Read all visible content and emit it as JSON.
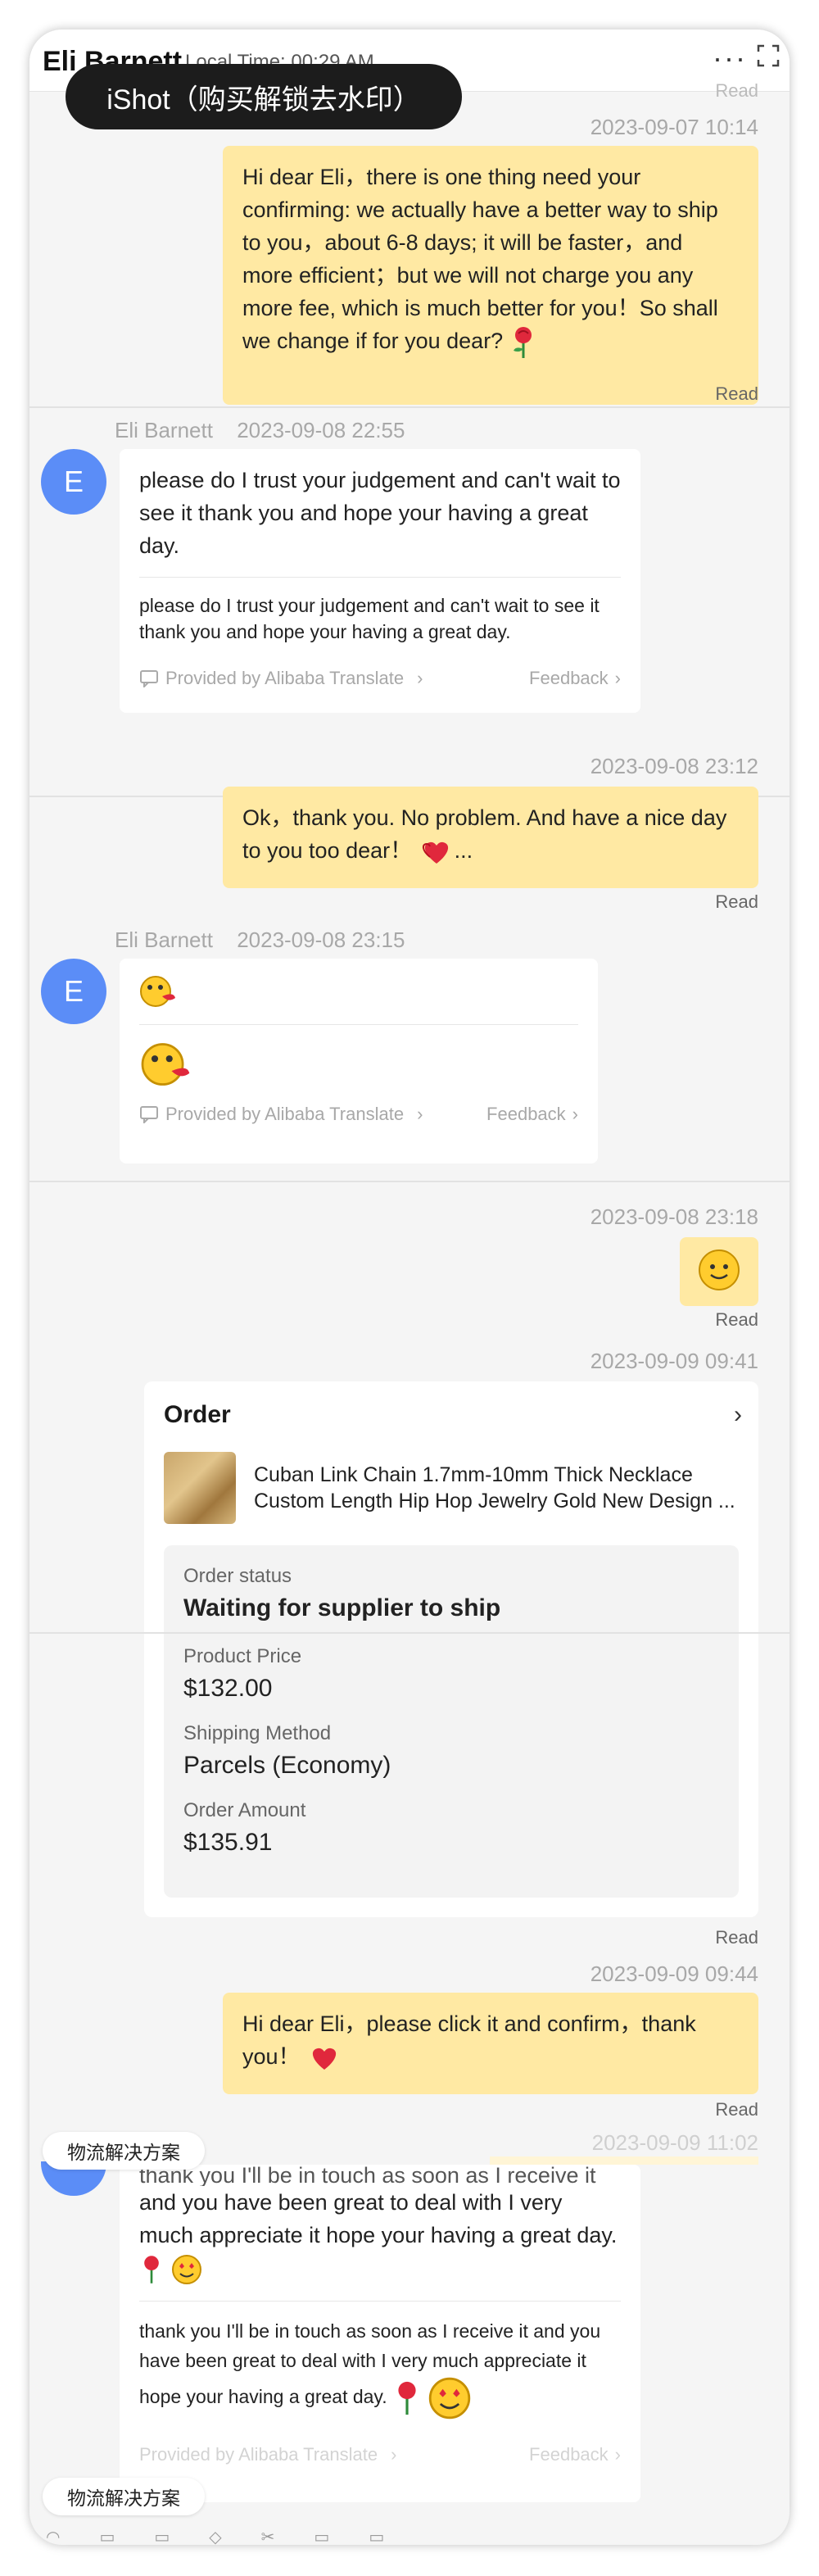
{
  "header": {
    "contact_name": "Eli Barnett",
    "local_time": "Local Time: 00:29 AM",
    "more_icon": "more-horizontal-icon",
    "expand_icon": "fullscreen-icon"
  },
  "watermark": "iShot（购买解锁去水印）",
  "top_read": "Read",
  "messages": {
    "m1": {
      "time": "2023-09-07 10:14",
      "text": "Hi dear Eli，there is one thing need your confirming: we actually have a better way to ship to you，about 6-8 days; it will be faster，and more efficient；but we will not charge you any more fee, which is much better for you！So shall we change if for you dear?",
      "emoji": "rose-icon",
      "status": "Read"
    },
    "m2": {
      "sender": "Eli Barnett",
      "time": "2023-09-08 22:55",
      "avatar": "E",
      "text": "please do I trust your judgement and can't wait to see it thank you and hope your having a great day.",
      "translation": "please do I trust your judgement and can't wait to see it thank you and hope your having a great day.",
      "provided": "Provided by Alibaba Translate",
      "feedback": "Feedback"
    },
    "m3": {
      "time": "2023-09-08 23:12",
      "text": "Ok，thank you. No problem. And have a nice day to you too dear！",
      "trail": "...",
      "status": "Read"
    },
    "m4": {
      "sender": "Eli Barnett",
      "time": "2023-09-08 23:15",
      "avatar": "E",
      "provided": "Provided by Alibaba Translate",
      "feedback": "Feedback"
    },
    "m5": {
      "time": "2023-09-08 23:18",
      "status": "Read"
    },
    "m6": {
      "time": "2023-09-09 09:41",
      "status": "Read"
    },
    "m7": {
      "time": "2023-09-09 09:44",
      "text": "Hi dear Eli，please click it and confirm，thank you！",
      "status": "Read"
    },
    "m8": {
      "time": "2023-09-09 11:02",
      "cut_line": "thank you I'll be in touch as soon as I receive it",
      "text": "and you have been great to deal with I very much appreciate it hope your having a great day.",
      "translation": "thank you I'll be in touch as soon as I receive it and you have been great to deal with I very much appreciate it hope your having a great day.",
      "provided": "Provided by Alibaba Translate",
      "feedback": "Feedback"
    }
  },
  "order": {
    "title": "Order",
    "product_line1": "Cuban Link Chain 1.7mm-10mm Thick Necklace",
    "product_line2": "Custom Length Hip Hop Jewelry Gold New Design ...",
    "status_label": "Order status",
    "status_value": "Waiting for supplier to ship",
    "price_label": "Product Price",
    "price_value": "$132.00",
    "shipping_label": "Shipping Method",
    "shipping_value": "Parcels (Economy)",
    "amount_label": "Order Amount",
    "amount_value": "$135.91"
  },
  "chips": {
    "logistics_1": "物流解决方案",
    "logistics_2": "物流解决方案"
  },
  "colors": {
    "outgoing_bubble": "#ffe9a3",
    "avatar": "#5b8df7",
    "timestamp": "#a8a8a8"
  }
}
